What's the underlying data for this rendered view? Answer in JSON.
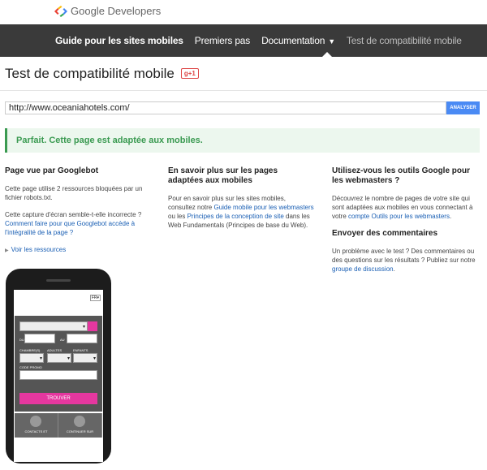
{
  "header": {
    "brand": "Google Developers"
  },
  "nav": {
    "items": [
      {
        "label": "Guide pour les sites mobiles"
      },
      {
        "label": "Premiers pas"
      },
      {
        "label": "Documentation"
      },
      {
        "label": "Test de compatibilité mobile"
      }
    ]
  },
  "page": {
    "title": "Test de compatibilité mobile",
    "gplus": "g+1"
  },
  "search": {
    "url": "http://www.oceaniahotels.com/",
    "analyze_label": "ANALYSER"
  },
  "result": {
    "message": "Parfait. Cette page est adaptée aux mobiles."
  },
  "col1": {
    "heading": "Page vue par Googlebot",
    "p1": "Cette page utilise 2 ressources bloquées par un fichier robots.txt.",
    "p2": "Cette capture d'écran semble-t-elle incorrecte ?",
    "link": "Comment faire pour que Googlebot accède à l'intégralité de la page ?",
    "resources": "Voir les ressources"
  },
  "col2": {
    "heading": "En savoir plus sur les pages adaptées aux mobiles",
    "t1": "Pour en savoir plus sur les sites mobiles, consultez notre ",
    "l1": "Guide mobile pour les webmasters",
    "t2": " ou les ",
    "l2": "Principes de la conception de site",
    "t3": " dans les Web Fundamentals (Principes de base du Web)."
  },
  "col3": {
    "heading": "Utilisez-vous les outils Google pour les webmasters ?",
    "t1": "Découvrez le nombre de pages de votre site qui sont adaptées aux mobiles en vous connectant à votre ",
    "l1": "compte Outils pour les webmasters",
    "t2": ".",
    "heading2": "Envoyer des commentaires",
    "t3": "Un problème avec le test ? Des commentaires ou des questions sur les résultats ? Publiez sur notre ",
    "l2": "groupe de discussion",
    "t4": "."
  },
  "phone": {
    "lang": "FR",
    "du": "DU",
    "au": "AU",
    "chambres": "CHAMBRE(S)",
    "adultes": "ADULTES",
    "enfants": "ENFANTS",
    "promo": "CODE PROMO",
    "trouver": "TROUVER",
    "contacts": "CONTACTS ET",
    "continuer": "CONTINUER SUR"
  },
  "colors": {
    "nav_bg": "#3a3a3a",
    "success": "#3a9a51",
    "accent_pink": "#e5379f",
    "button_blue": "#4a8af4"
  }
}
